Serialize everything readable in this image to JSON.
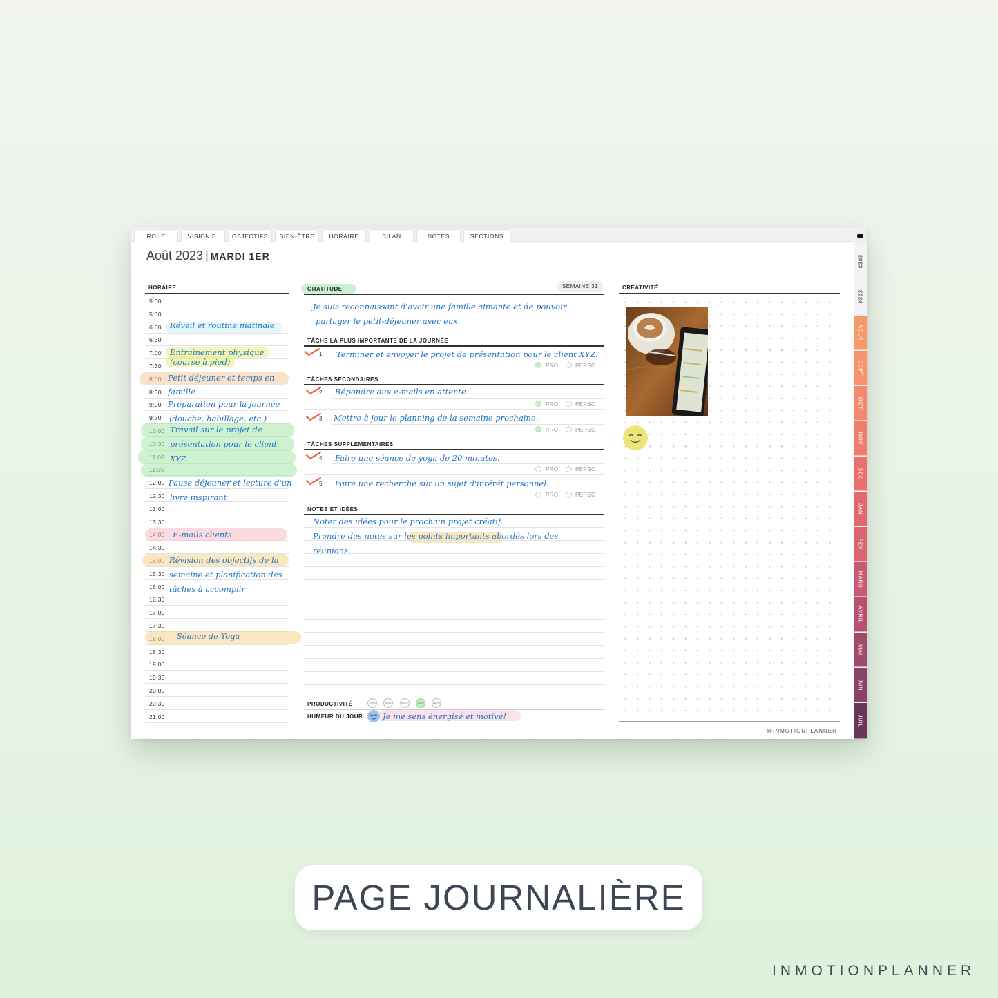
{
  "nav": {
    "tabs": [
      "ROUE",
      "VISION B.",
      "OBJECTIFS",
      "BIEN-ÊTRE",
      "HORAIRE",
      "BILAN",
      "NOTES",
      "SECTIONS"
    ]
  },
  "header": {
    "month": "Août 2023",
    "separator": "|",
    "day": "MARDI 1ER"
  },
  "schedule": {
    "heading": "HORAIRE",
    "times": [
      "5:00",
      "5:30",
      "6:00",
      "6:30",
      "7:00",
      "7:30",
      "8:00",
      "8:30",
      "9:00",
      "9:30",
      "10:00",
      "10:30",
      "11:00",
      "11:30",
      "12:00",
      "12:30",
      "13:00",
      "13:30",
      "14:00",
      "14:30",
      "15:00",
      "15:30",
      "16:00",
      "16:30",
      "17:00",
      "17:30",
      "18:00",
      "18:30",
      "19:00",
      "19:30",
      "20:00",
      "20:30",
      "21:00"
    ],
    "entries": [
      "Réveil et routine matinale",
      "Entraînement physique",
      "(course à pied)",
      "Petit déjeuner et temps en",
      "famille",
      "Préparation pour la journée",
      "(douche, habillage, etc.)",
      "Travail sur le projet de",
      "présentation pour le client",
      "XYZ",
      "Pause déjeuner et lecture d'un",
      "livre inspirant",
      "E-mails clients",
      "Révision des objectifs de la",
      "semaine et planification des",
      "tâches à accomplir",
      "Séance de Yoga"
    ]
  },
  "gratitude": {
    "heading": "GRATITUDE",
    "week": "SEMAINE 31",
    "lines": [
      "Je suis reconnaissant d'avoir une famille aimante et de pouvoir",
      "partager le petit-déjeuner avec eux."
    ]
  },
  "main_task": {
    "heading": "TÂCHE LA PLUS IMPORTANTE DE LA JOURNÉE",
    "num": "1",
    "text": "Terminer et envoyer le projet de présentation pour le client XYZ."
  },
  "secondary": {
    "heading": "TÂCHES SECONDAIRES",
    "items": [
      {
        "num": "2",
        "text": "Répondre aux e-mails en attente."
      },
      {
        "num": "3",
        "text": "Mettre à jour le planning de la semaine prochaine."
      }
    ]
  },
  "extra": {
    "heading": "TÂCHES SUPPLÉMENTAIRES",
    "items": [
      {
        "num": "4",
        "text": "Faire une séance de yoga de 20 minutes."
      },
      {
        "num": "5",
        "text": "Faire une recherche sur un sujet d'intérêt personnel."
      }
    ]
  },
  "tags": {
    "pro": "PRO",
    "perso": "PERSO"
  },
  "notes": {
    "heading": "NOTES ET IDÉES",
    "lines": [
      "Noter des idées pour le prochain projet créatif.",
      "Prendre des notes sur les points importants abordés lors des",
      "réunions."
    ]
  },
  "productivity": {
    "label": "PRODUCTIVITÉ",
    "levels": [
      "20%",
      "40%",
      "60%",
      "80%",
      "100%"
    ],
    "selected": "80%"
  },
  "mood": {
    "label": "HUMEUR DU JOUR",
    "text": "Je me sens énergisé et motivé!"
  },
  "creativity": {
    "heading": "CRÉATIVITÉ"
  },
  "handle": "@INMOTIONPLANNER",
  "side_tabs": [
    "2023",
    "2024",
    "AOÛT",
    "SEPT",
    "OCT",
    "NOV",
    "DÉC",
    "JAN",
    "FÉV",
    "MARS",
    "AVRIL",
    "MAI",
    "JUN",
    "JUIL"
  ],
  "colors": {
    "ink": "#1f74c4",
    "check": "#e85a2e",
    "aug": "#f79a6a",
    "sep": "#f6956d",
    "oct": "#f38a6c",
    "nov": "#ef7e6d",
    "dec": "#ea6f6e",
    "jan": "#e2686f",
    "feb": "#d9656f",
    "mar": "#c95a72",
    "apr": "#b8516f",
    "may": "#a24a6c",
    "jun": "#8b4266",
    "jul": "#6b3556"
  },
  "footer": {
    "title": "PAGE JOURNALIÈRE",
    "brand": "INMOTIONPLANNER"
  }
}
